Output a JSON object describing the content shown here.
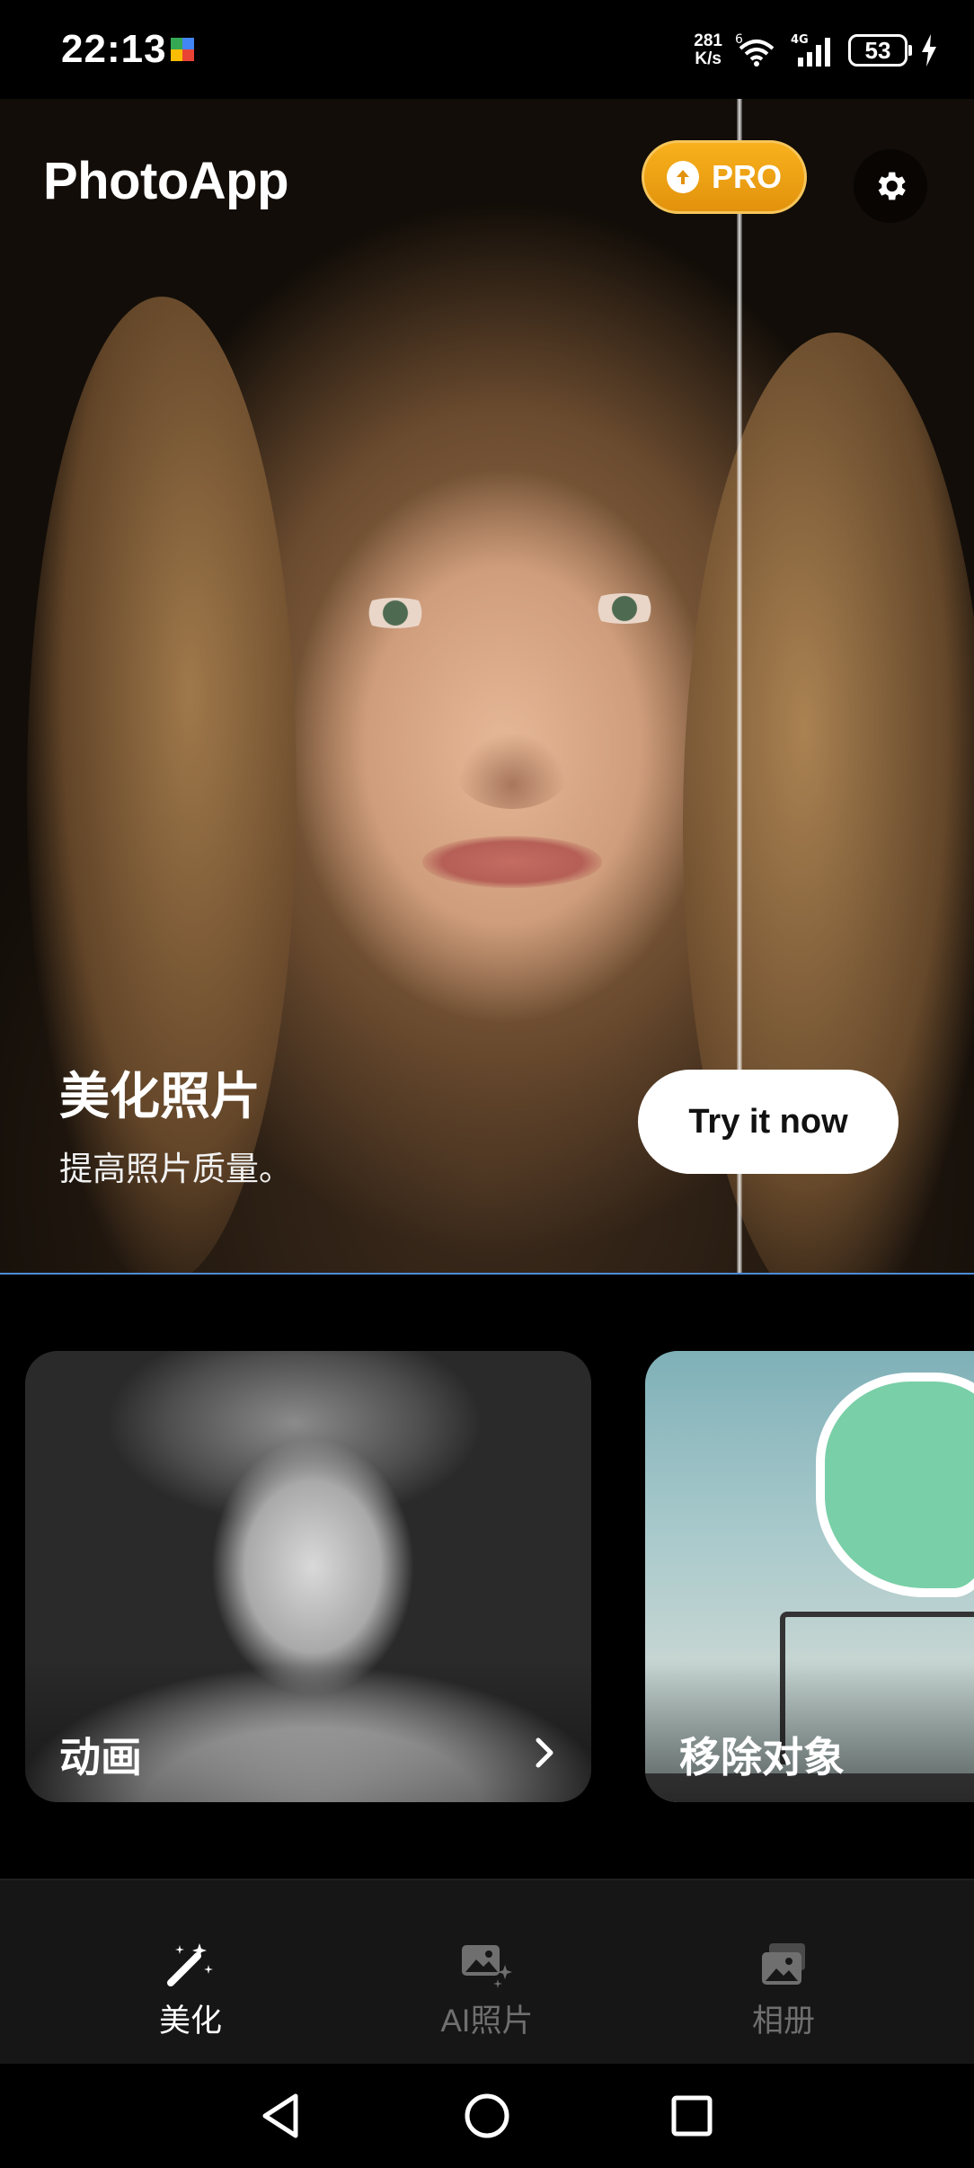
{
  "status_bar": {
    "time": "22:13",
    "net_speed_value": "281",
    "net_speed_unit": "K/s",
    "battery": "53",
    "network_type": "4G",
    "wifi_label": "6"
  },
  "header": {
    "app_title": "PhotoApp",
    "pro_label": "PRO"
  },
  "hero": {
    "heading": "美化照片",
    "subtitle": "提高照片质量。",
    "cta_label": "Try it now"
  },
  "cards": [
    {
      "label": "动画"
    },
    {
      "label": "移除对象"
    }
  ],
  "bottom_nav": {
    "items": [
      {
        "label": "美化",
        "icon": "magic-wand-icon",
        "active": true
      },
      {
        "label": "AI照片",
        "icon": "ai-photo-icon",
        "active": false
      },
      {
        "label": "相册",
        "icon": "gallery-icon",
        "active": false
      }
    ]
  },
  "colors": {
    "pro_gradient": "#f8b11d",
    "accent_line": "#4e8cd8",
    "nav_inactive": "#6f6f6f"
  }
}
